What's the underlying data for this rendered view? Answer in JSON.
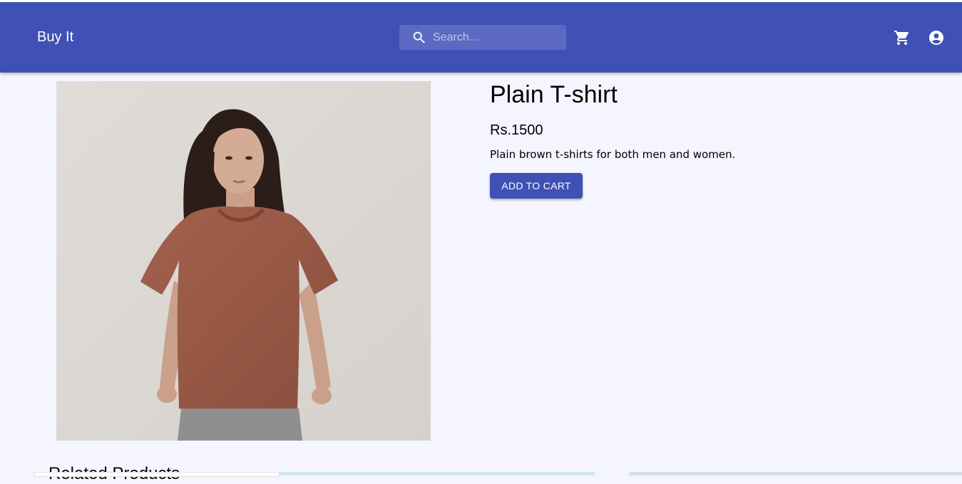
{
  "appbar": {
    "brand": "Buy It",
    "search_placeholder": "Search...",
    "color": "#3f51b5"
  },
  "product": {
    "title": "Plain T-shirt",
    "price": "Rs.1500",
    "description": "Plain brown t-shirts for both men and women.",
    "add_to_cart_label": "ADD TO CART",
    "shirt_color": "#9c5b48"
  },
  "related": {
    "heading": "Related Products"
  }
}
